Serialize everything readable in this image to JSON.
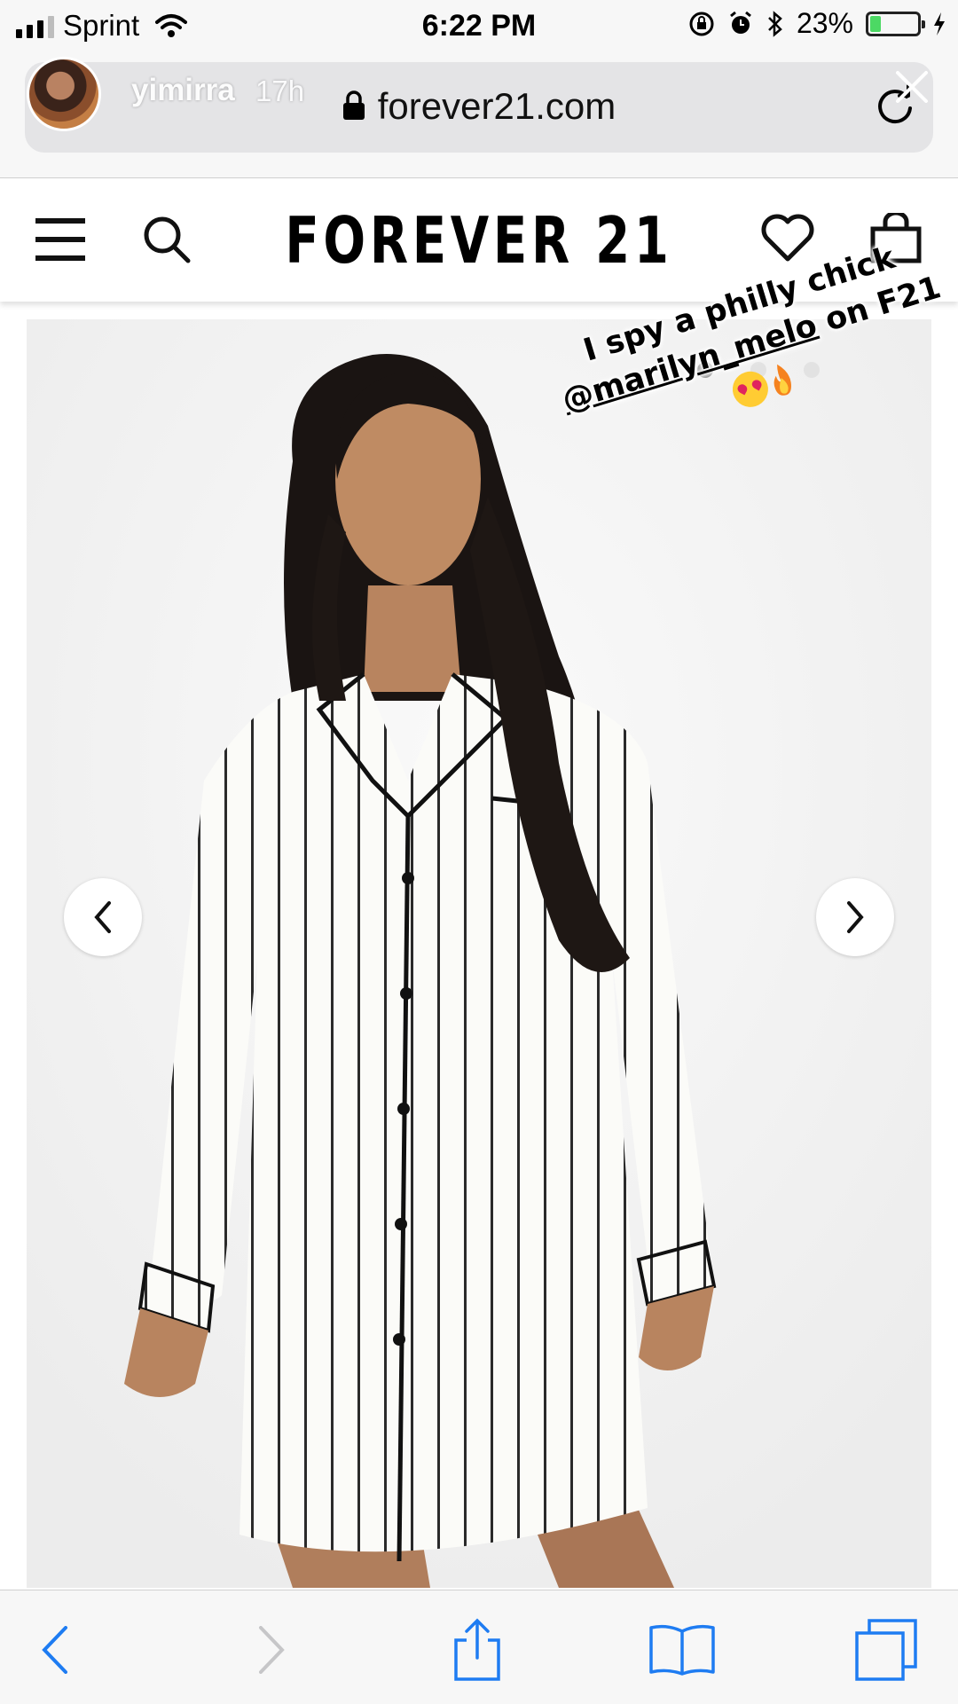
{
  "status": {
    "carrier": "Sprint",
    "time": "6:22 PM",
    "battery_percent": "23%",
    "battery_level": 0.23
  },
  "story": {
    "username": "yimirra",
    "age": "17h"
  },
  "browser": {
    "url": "forever21.com"
  },
  "site": {
    "logo": "FOREVER 21"
  },
  "product": {
    "image": "model-in-white-striped-pajama-shirt-dress",
    "carousel_total": 3,
    "carousel_active": 0
  },
  "sticker": {
    "line1": "I spy a philly chick",
    "mention": "@marilyn_melo",
    "line2_suffix": " on F21"
  },
  "colors": {
    "ios_blue": "#1e7cf2",
    "battery_green": "#4cd964"
  }
}
